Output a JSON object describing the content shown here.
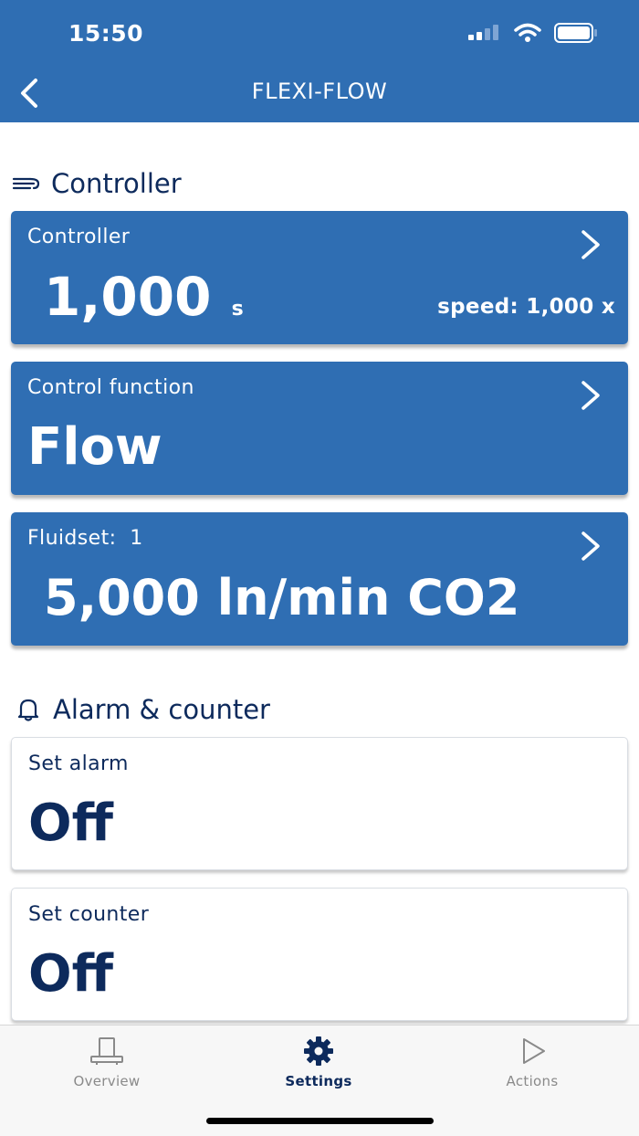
{
  "status_bar": {
    "time": "15:50"
  },
  "header": {
    "title": "FLEXI-FLOW"
  },
  "sections": {
    "controller": {
      "title": "Controller"
    },
    "alarm": {
      "title": "Alarm & counter"
    }
  },
  "cards": {
    "controller": {
      "label": "Controller",
      "value": "1,000",
      "unit": "s",
      "speed": "speed: 1,000 x"
    },
    "control_function": {
      "label": "Control function",
      "value": "Flow"
    },
    "fluidset": {
      "label": "Fluidset:  1",
      "value": "5,000 ln/min CO2"
    },
    "set_alarm": {
      "label": "Set alarm",
      "value": "Off"
    },
    "set_counter": {
      "label": "Set counter",
      "value": "Off"
    }
  },
  "tabs": [
    {
      "label": "Overview",
      "icon": "device-icon",
      "active": false
    },
    {
      "label": "Settings",
      "icon": "gear-icon",
      "active": true
    },
    {
      "label": "Actions",
      "icon": "play-icon",
      "active": false
    }
  ],
  "colors": {
    "header": "#2f6eb3",
    "card_blue": "#2f6eb3",
    "text_dark": "#0d2a5c",
    "tab_active": "#0d2a5c",
    "tab_inactive": "#8a8a8a"
  }
}
